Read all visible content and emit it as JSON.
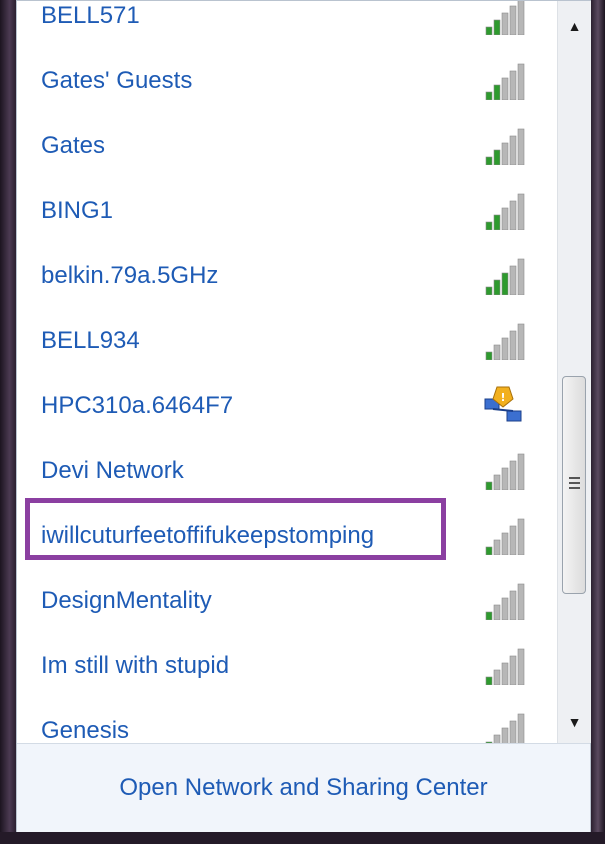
{
  "networks": [
    {
      "name": "BELL571",
      "secured": false
    },
    {
      "name": "Gates' Guests",
      "secured": false
    },
    {
      "name": "Gates",
      "secured": false
    },
    {
      "name": "BING1",
      "secured": false
    },
    {
      "name": "belkin.79a.5GHz",
      "secured": false
    },
    {
      "name": "BELL934",
      "secured": false
    },
    {
      "name": "HPC310a.6464F7",
      "secured": true
    },
    {
      "name": "Devi Network",
      "secured": false
    },
    {
      "name": "iwillcuturfeetoffifukeepstomping",
      "secured": false
    },
    {
      "name": "DesignMentality",
      "secured": false
    },
    {
      "name": "Im still with stupid",
      "secured": false
    },
    {
      "name": "Genesis",
      "secured": false
    }
  ],
  "signal_bars": [
    2,
    2,
    2,
    2,
    3,
    1,
    0,
    1,
    1,
    1,
    1,
    1
  ],
  "highlighted_network": "iwillcuturfeetoffifukeepstomping",
  "footer": {
    "link_label": "Open Network and Sharing Center"
  },
  "colors": {
    "link": "#1e5bb5",
    "highlight": "#8b3fa1",
    "signal_green": "#2e9a2e",
    "signal_gray": "#b7b7b7"
  }
}
